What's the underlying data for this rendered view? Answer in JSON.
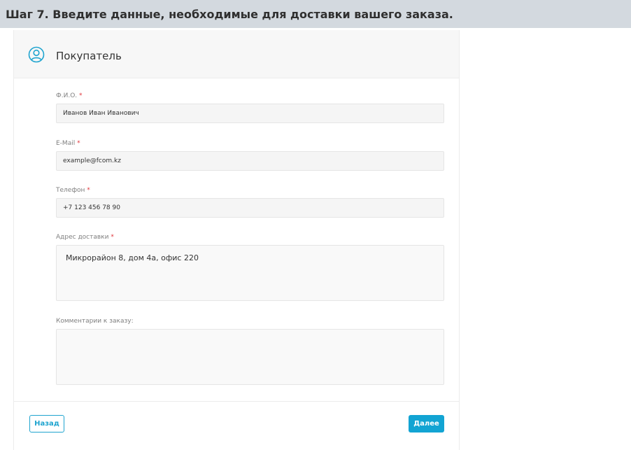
{
  "banner": {
    "text": "Шаг 7. Введите данные, необходимые для доставки вашего заказа."
  },
  "buyer": {
    "title": "Покупатель"
  },
  "form": {
    "required_mark": "*",
    "fio": {
      "label": "Ф.И.О.",
      "value": "Иванов Иван Иванович"
    },
    "email": {
      "label": "E-Mail",
      "value": "example@fcom.kz"
    },
    "phone": {
      "label": "Телефон",
      "value": "+7 123 456 78 90"
    },
    "address": {
      "label": "Адрес доставки",
      "value": "Микрорайон 8, дом 4а, офис 220"
    },
    "comment": {
      "label": "Комментарии к заказу:",
      "value": ""
    }
  },
  "buttons": {
    "back": "Назад",
    "next": "Далее"
  },
  "colors": {
    "accent": "#12a4d3",
    "required": "#e0353b",
    "banner_bg": "#d3d9df"
  },
  "icons": {
    "buyer": "user-circle-icon"
  }
}
